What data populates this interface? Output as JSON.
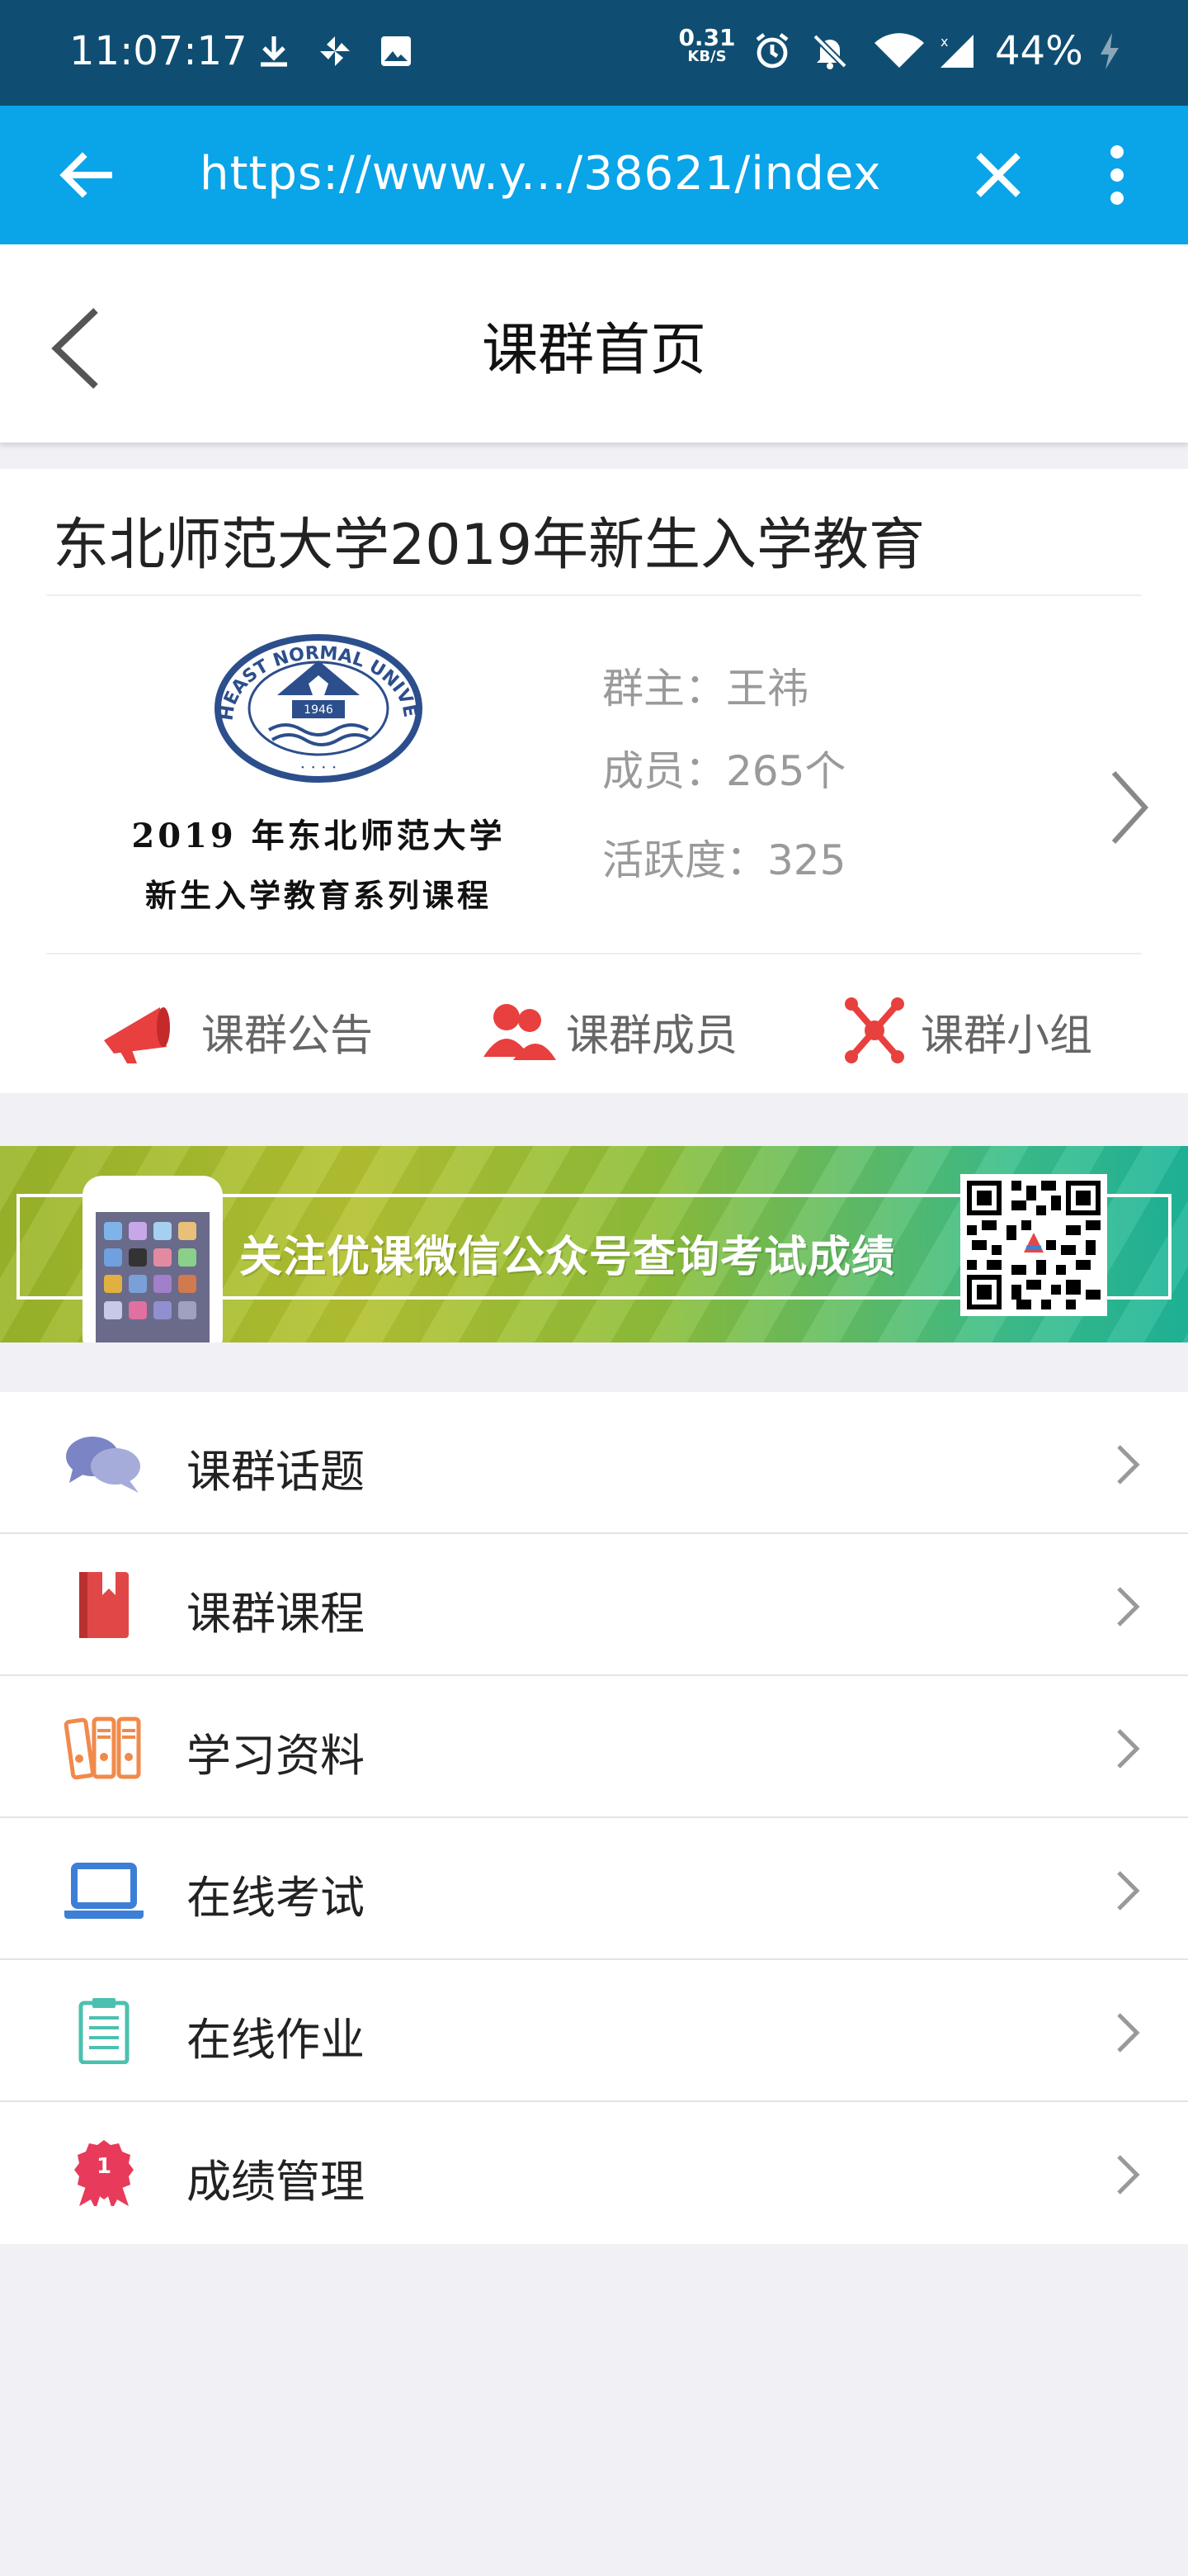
{
  "status_bar": {
    "time": "11:07:17",
    "net_speed_value": "0.31",
    "net_speed_unit": "KB/S",
    "battery": "44%",
    "icons": [
      "download-icon",
      "pinwheel-icon",
      "image-icon",
      "alarm-icon",
      "bell-off-icon",
      "wifi-icon",
      "signal-icon",
      "battery-icon"
    ]
  },
  "browser": {
    "url": "https://www.y.../38621/index",
    "back_icon": "arrow-left-icon",
    "close_icon": "close-icon",
    "menu_icon": "more-vertical-icon",
    "bar_color": "#0aa4e8"
  },
  "header": {
    "title": "课群首页",
    "back_icon": "chevron-left-icon"
  },
  "group": {
    "name": "东北师范大学2019年新生入学教育",
    "logo_text_line1": "2019 年东北师范大学",
    "logo_text_line2": "新生入学教育系列课程",
    "logo_seal_text": "NORTHEAST NORMAL UNIVERSITY",
    "owner": "群主：王祎",
    "members": "成员：265个",
    "activity": "活跃度：325"
  },
  "quick_actions": [
    {
      "label": "课群公告",
      "icon": "megaphone-icon",
      "color": "#e8403f"
    },
    {
      "label": "课群成员",
      "icon": "members-icon",
      "color": "#e8403f"
    },
    {
      "label": "课群小组",
      "icon": "group-nodes-icon",
      "color": "#e8403f"
    }
  ],
  "banner": {
    "text": "关注优课微信公众号查询考试成绩"
  },
  "menu": [
    {
      "label": "课群话题",
      "icon": "chat-bubbles-icon",
      "color": "#7b84c4"
    },
    {
      "label": "课群课程",
      "icon": "book-icon",
      "color": "#e04848"
    },
    {
      "label": "学习资料",
      "icon": "binders-icon",
      "color": "#f08a4b"
    },
    {
      "label": "在线考试",
      "icon": "laptop-icon",
      "color": "#3d7fd6"
    },
    {
      "label": "在线作业",
      "icon": "clipboard-icon",
      "color": "#4cc0b0"
    },
    {
      "label": "成绩管理",
      "icon": "award-badge-icon",
      "color": "#e83a5a"
    }
  ]
}
